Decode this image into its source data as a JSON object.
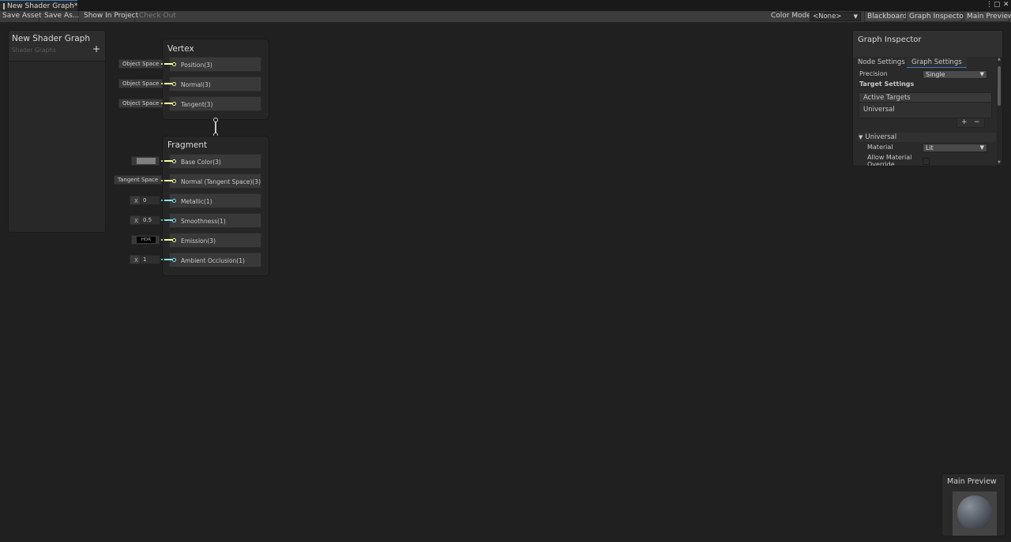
{
  "window": {
    "tab_title": "New Shader Graph*",
    "controls": [
      "⋮",
      "▢",
      "✕"
    ]
  },
  "toolbar": {
    "save_asset": "Save Asset",
    "save_as": "Save As...",
    "show_in_project": "Show In Project",
    "check_out": "Check Out",
    "color_mode_label": "Color Mode",
    "color_mode_value": "<None>",
    "blackboard": "Blackboard",
    "graph_inspector": "Graph Inspector",
    "main_preview": "Main Preview"
  },
  "blackboard": {
    "title": "New Shader Graph",
    "subtitle": "Shader Graphs",
    "add": "+"
  },
  "vertex": {
    "title": "Vertex",
    "blocks": [
      {
        "label": "Position(3)",
        "input": "Object Space"
      },
      {
        "label": "Normal(3)",
        "input": "Object Space"
      },
      {
        "label": "Tangent(3)",
        "input": "Object Space"
      }
    ]
  },
  "fragment": {
    "title": "Fragment",
    "blocks": [
      {
        "label": "Base Color(3)",
        "input_type": "color",
        "color": "#7f7f7f"
      },
      {
        "label": "Normal (Tangent Space)(3)",
        "input": "Tangent Space"
      },
      {
        "label": "Metallic(1)",
        "x_label": "X",
        "value": "0"
      },
      {
        "label": "Smoothness(1)",
        "x_label": "X",
        "value": "0.5"
      },
      {
        "label": "Emission(3)",
        "input_type": "hdr",
        "hdr_label": "HDR"
      },
      {
        "label": "Ambient Occlusion(1)",
        "x_label": "X",
        "value": "1"
      }
    ]
  },
  "inspector": {
    "title": "Graph Inspector",
    "tabs": [
      "Node Settings",
      "Graph Settings"
    ],
    "active_tab": "Graph Settings",
    "precision_label": "Precision",
    "precision_value": "Single",
    "target_settings": "Target Settings",
    "active_targets": "Active Targets",
    "target_item": "Universal",
    "list_add": "+",
    "list_remove": "−",
    "section": "Universal",
    "material_label": "Material",
    "material_value": "Lit",
    "allow_override_label": "Allow Material Override"
  },
  "preview": {
    "title": "Main Preview"
  },
  "colors": {
    "vec3_port": "#f6ff9a",
    "vec1_port": "#84e4e7",
    "accent": "#3a79bb"
  }
}
